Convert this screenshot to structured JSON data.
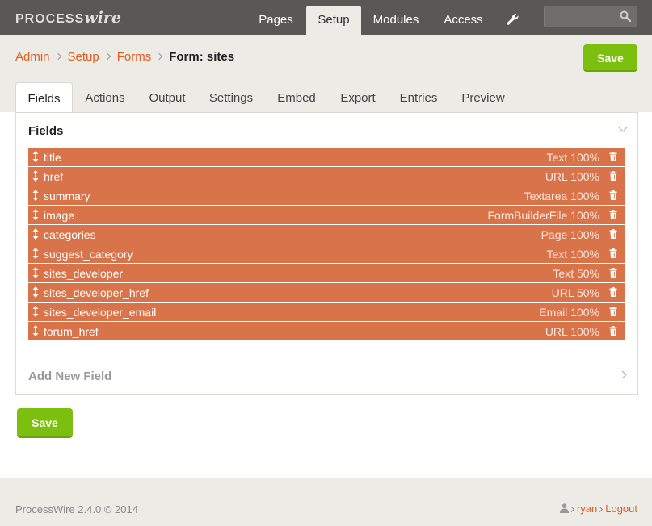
{
  "brand": {
    "logo_prefix": "PROCESS",
    "logo_suffix": "wire"
  },
  "nav": {
    "items": [
      {
        "label": "Pages"
      },
      {
        "label": "Setup"
      },
      {
        "label": "Modules"
      },
      {
        "label": "Access"
      }
    ],
    "active": "Setup",
    "tools_icon": "wrench-icon",
    "search_placeholder": ""
  },
  "breadcrumbs": {
    "items": [
      "Admin",
      "Setup",
      "Forms"
    ],
    "current": "Form: sites"
  },
  "buttons": {
    "save_top": "Save",
    "save_bottom": "Save"
  },
  "tabs": {
    "items": [
      "Fields",
      "Actions",
      "Output",
      "Settings",
      "Embed",
      "Export",
      "Entries",
      "Preview"
    ],
    "active": "Fields"
  },
  "fields_panel": {
    "title": "Fields",
    "rows": [
      {
        "name": "title",
        "type": "Text 100%"
      },
      {
        "name": "href",
        "type": "URL 100%"
      },
      {
        "name": "summary",
        "type": "Textarea 100%"
      },
      {
        "name": "image",
        "type": "FormBuilderFile 100%"
      },
      {
        "name": "categories",
        "type": "Page 100%"
      },
      {
        "name": "suggest_category",
        "type": "Text 100%"
      },
      {
        "name": "sites_developer",
        "type": "Text 50%"
      },
      {
        "name": "sites_developer_href",
        "type": "URL 50%"
      },
      {
        "name": "sites_developer_email",
        "type": "Email 100%"
      },
      {
        "name": "forum_href",
        "type": "URL 100%"
      }
    ]
  },
  "add_field": {
    "label": "Add New Field"
  },
  "footer": {
    "copyright": "ProcessWire 2.4.0 © 2014",
    "user": "ryan",
    "logout": "Logout"
  },
  "colors": {
    "topbar": "#595854",
    "accent": "#e05d22",
    "field_row": "#d9734a",
    "save_button": "#7dbf0f"
  }
}
